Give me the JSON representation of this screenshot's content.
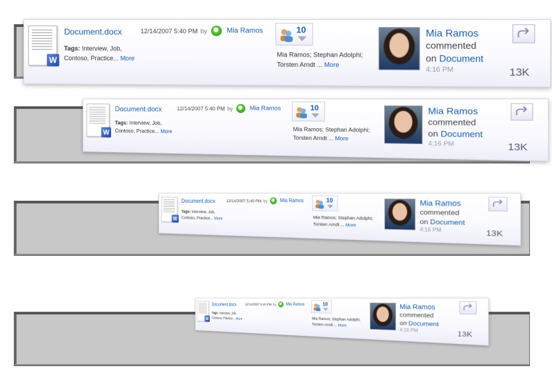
{
  "card": {
    "document_title": "Document.docx",
    "tags_label": "Tags:",
    "tags_value": "Interview, Job, Contoso, Practice...",
    "more_label": "More",
    "date": "12/14/2007 5:40 PM",
    "by_label": "by",
    "author": "Mia Ramos",
    "people_count": "10",
    "people_names": "Mia Ramos;  Stephan Adolphi; Torsten Arndt ...",
    "activity_name": "Mia Ramos",
    "activity_verb": "commented",
    "activity_on": "on",
    "activity_target": "Document",
    "activity_time": "4:16 PM",
    "views_count": "13K"
  },
  "colors": {
    "link": "#1a5ea8",
    "track": "#c8c8c8",
    "presence": "#5bbf3a"
  },
  "icons": {
    "document": "word-document-icon",
    "presence": "presence-online-icon",
    "people": "people-group-icon",
    "dropdown": "dropdown-arrow-icon",
    "reply": "reply-arrow-icon"
  }
}
